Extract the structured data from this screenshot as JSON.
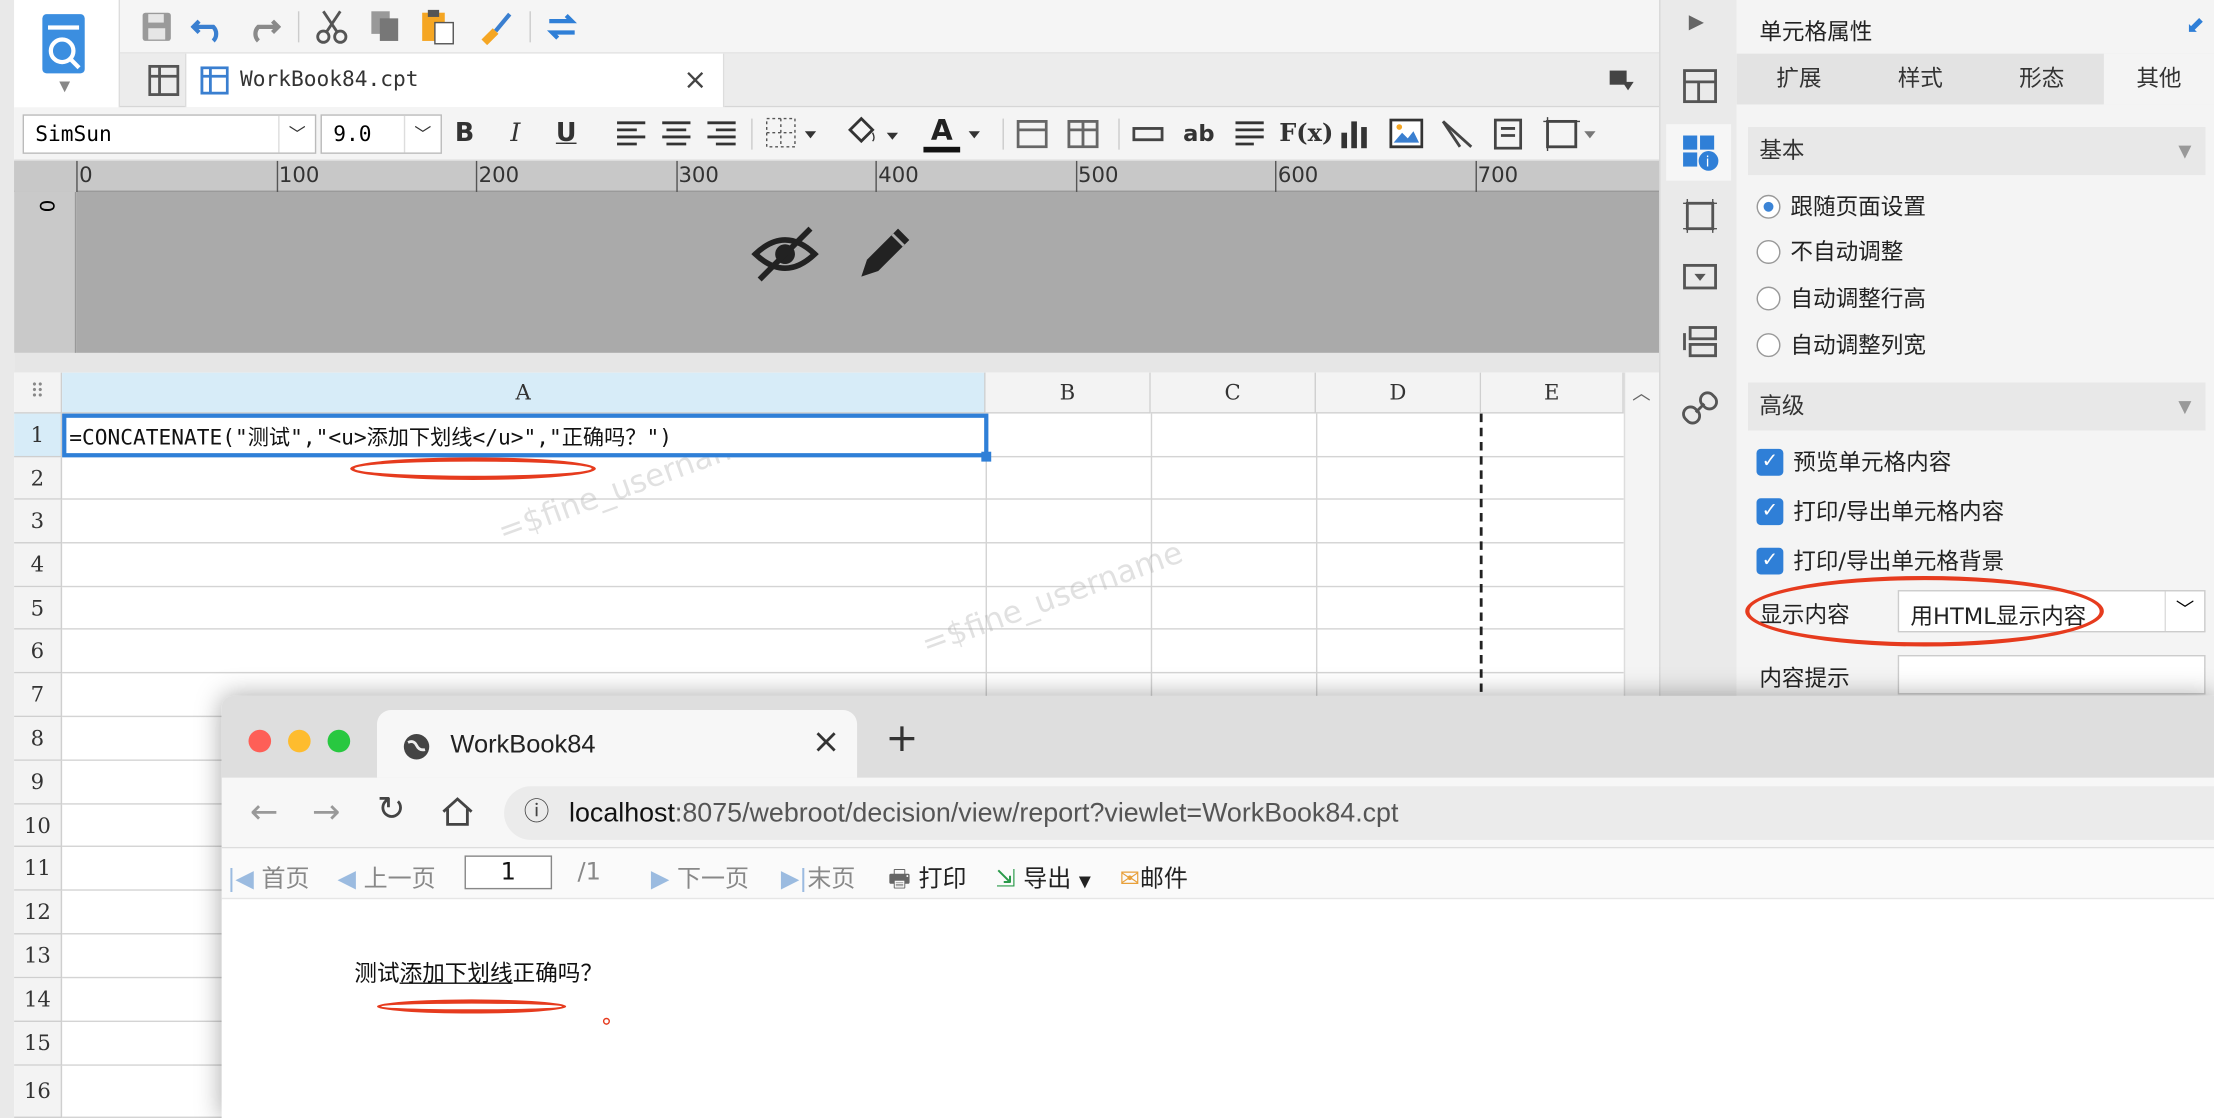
{
  "toolbar": {
    "font_name": "SimSun",
    "font_size": "9.0",
    "bold": "B",
    "italic": "I",
    "underline": "U",
    "fx_label": "F(x)",
    "ab_label": "ab"
  },
  "tab": {
    "title": "WorkBook84.cpt"
  },
  "ruler": {
    "marks": [
      "0",
      "100",
      "200",
      "300",
      "400",
      "500",
      "600",
      "700"
    ],
    "vertical_zero": "0"
  },
  "sheet": {
    "columns": [
      "A",
      "B",
      "C",
      "D",
      "E"
    ],
    "rows": [
      "1",
      "2",
      "3",
      "4",
      "5",
      "6",
      "7",
      "8",
      "9",
      "10",
      "11",
      "12",
      "13",
      "14",
      "15",
      "16"
    ],
    "cell_a1": "=CONCATENATE(\"测试\",\"<u>添加下划线</u>\",\"正确吗？\")",
    "watermark": "=$fine_username"
  },
  "panel": {
    "title": "单元格属性",
    "tabs": [
      "扩展",
      "样式",
      "形态",
      "其他"
    ],
    "basic_section": "基本",
    "basic_options": [
      "跟随页面设置",
      "不自动调整",
      "自动调整行高",
      "自动调整列宽"
    ],
    "advanced_section": "高级",
    "checks": [
      "预览单元格内容",
      "打印/导出单元格内容",
      "打印/导出单元格背景"
    ],
    "display_label": "显示内容",
    "display_value": "用HTML显示内容",
    "tooltip_label": "内容提示"
  },
  "browser": {
    "tab_title": "WorkBook84",
    "url_host": "localhost",
    "url_rest": ":8075/webroot/decision/view/report?viewlet=WorkBook84.cpt",
    "toolbar": {
      "first": "首页",
      "prev": "上一页",
      "page_value": "1",
      "page_total": "/1",
      "next": "下一页",
      "last": "末页",
      "print": "打印",
      "export": "导出",
      "mail": "邮件"
    },
    "result_before": "测试",
    "result_underlined": "添加下划线",
    "result_after": "正确吗？"
  },
  "colors": {
    "selection": "#2f7fd7",
    "annotation": "#e63b1e",
    "active_col_header": "#d7ecf8"
  }
}
